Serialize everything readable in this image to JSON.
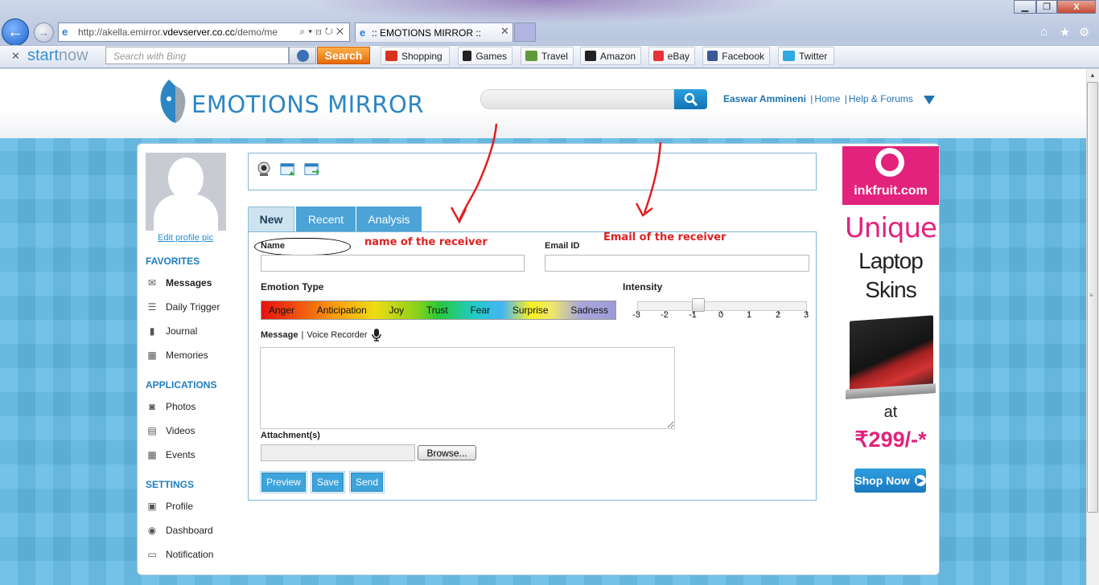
{
  "browser": {
    "url_prefix": "http://akella.emirror.",
    "url_domain": "vdevserver.co.cc",
    "url_suffix": "/demo/me",
    "tab_title": ":: EMOTIONS MIRROR ::",
    "window_buttons": {
      "minimize": "▁",
      "maximize": "❐",
      "close": "X"
    },
    "right_icons": {
      "home": "⌂",
      "favorites": "★",
      "tools": "⚙"
    }
  },
  "toolbar": {
    "brand_start": "start",
    "brand_now": "now",
    "search_placeholder": "Search with Bing",
    "search_button": "Search",
    "links": [
      {
        "label": "Shopping",
        "icon": "shopping-bag-icon",
        "color": "#d9321f"
      },
      {
        "label": "Games",
        "icon": "chess-knight-icon",
        "color": "#222222"
      },
      {
        "label": "Travel",
        "icon": "airplane-icon",
        "color": "#5f9a3a"
      },
      {
        "label": "Amazon",
        "icon": "amazon-icon",
        "color": "#222222"
      },
      {
        "label": "eBay",
        "icon": "ebay-icon",
        "color": "#e53238"
      },
      {
        "label": "Facebook",
        "icon": "facebook-icon",
        "color": "#3b5998"
      },
      {
        "label": "Twitter",
        "icon": "twitter-bird-icon",
        "color": "#2fa9e0"
      }
    ]
  },
  "site": {
    "brand": "EMOTIONS MIRROR",
    "search_placeholder": "",
    "user_name": "Easwar Ammineni",
    "nav": [
      "Home",
      "Help & Forums"
    ],
    "separator": "|"
  },
  "sidebar": {
    "edit_pic": "Edit profile pic",
    "sections": [
      {
        "title": "FAVORITES",
        "items": [
          {
            "label": "Messages",
            "icon": "envelope-icon",
            "active": true
          },
          {
            "label": "Daily Trigger",
            "icon": "trigger-list-icon"
          },
          {
            "label": "Journal",
            "icon": "book-icon"
          },
          {
            "label": "Memories",
            "icon": "calendar-icon"
          }
        ]
      },
      {
        "title": "APPLICATIONS",
        "items": [
          {
            "label": "Photos",
            "icon": "camera-icon"
          },
          {
            "label": "Videos",
            "icon": "film-icon"
          },
          {
            "label": "Events",
            "icon": "event-calendar-icon"
          }
        ]
      },
      {
        "title": "SETTINGS",
        "items": [
          {
            "label": "Profile",
            "icon": "profile-card-icon"
          },
          {
            "label": "Dashboard",
            "icon": "dashboard-globe-icon"
          },
          {
            "label": "Notification",
            "icon": "notification-icon"
          }
        ]
      }
    ]
  },
  "tabs": [
    "New",
    "Recent",
    "Analysis"
  ],
  "form": {
    "name_label": "Name",
    "email_label": "Email ID",
    "name_value": "",
    "email_value": "",
    "emotion_label": "Emotion Type",
    "emotions": [
      "Anger",
      "Anticipation",
      "Joy",
      "Trust",
      "Fear",
      "Surprise",
      "Sadness"
    ],
    "intensity_label": "Intensity",
    "intensity_ticks": [
      "-3",
      "-2",
      "-1",
      "0",
      "1",
      "2",
      "3"
    ],
    "intensity_value": -1,
    "message_label": "Message",
    "voice_label": "Voice Recorder",
    "message_sep": "|",
    "message_value": "",
    "attachment_label": "Attachment(s)",
    "browse_label": "Browse...",
    "buttons": [
      "Preview",
      "Save",
      "Send"
    ]
  },
  "annotations": {
    "name": "name of the receiver",
    "email": "Email of the receiver",
    "color": "#e02020"
  },
  "ad": {
    "brand": "inkfruit.com",
    "line1": "Unique",
    "line2": "Laptop",
    "line3": "Skins",
    "at": "at",
    "price": "₹299/-*",
    "cta": "Shop Now"
  }
}
